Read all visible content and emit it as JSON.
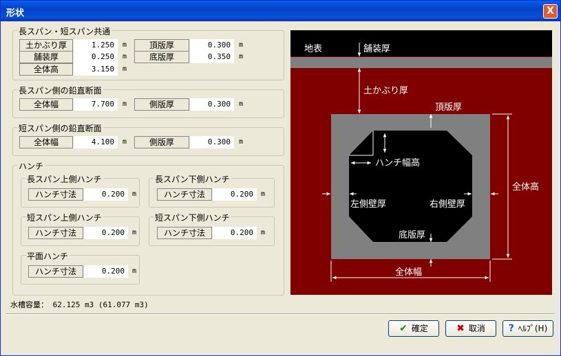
{
  "window": {
    "title": "形状",
    "close": "X"
  },
  "common": {
    "title": "長スパン・短スパン共通",
    "cover": {
      "label": "土かぶり厚",
      "value": "1.250",
      "unit": "m"
    },
    "pave": {
      "label": "舗装厚",
      "value": "0.250",
      "unit": "m"
    },
    "height": {
      "label": "全体高",
      "value": "3.150",
      "unit": "m"
    },
    "top": {
      "label": "頂版厚",
      "value": "0.300",
      "unit": "m"
    },
    "bottom": {
      "label": "底版厚",
      "value": "0.350",
      "unit": "m"
    }
  },
  "long": {
    "title": "長スパン側の鉛直断面",
    "width": {
      "label": "全体幅",
      "value": "7.700",
      "unit": "m"
    },
    "side": {
      "label": "側版厚",
      "value": "0.300",
      "unit": "m"
    }
  },
  "short": {
    "title": "短スパン側の鉛直断面",
    "width": {
      "label": "全体幅",
      "value": "4.100",
      "unit": "m"
    },
    "side": {
      "label": "側版厚",
      "value": "0.300",
      "unit": "m"
    }
  },
  "haunch": {
    "title": "ハンチ",
    "longUpper": {
      "title": "長スパン上側ハンチ",
      "label": "ハンチ寸法",
      "value": "0.200",
      "unit": "m"
    },
    "longLower": {
      "title": "長スパン下側ハンチ",
      "label": "ハンチ寸法",
      "value": "0.200",
      "unit": "m"
    },
    "shortUpper": {
      "title": "短スパン上側ハンチ",
      "label": "ハンチ寸法",
      "value": "0.200",
      "unit": "m"
    },
    "shortLower": {
      "title": "短スパン下側ハンチ",
      "label": "ハンチ寸法",
      "value": "0.200",
      "unit": "m"
    },
    "plane": {
      "title": "平面ハンチ",
      "label": "ハンチ寸法",
      "value": "0.200",
      "unit": "m"
    }
  },
  "status": "水槽容量： 62.125 m3 (61.077 m3)",
  "buttons": {
    "ok": "確定",
    "cancel": "取消",
    "help": "ﾍﾙﾌﾟ(H)"
  },
  "icons": {
    "ok": "check-icon",
    "cancel": "x-icon",
    "help": "question-icon"
  },
  "diagram": {
    "ground": "地表",
    "pave": "舗装厚",
    "cover": "土かぶり厚",
    "top": "頂版厚",
    "haunch": "ハンチ幅高",
    "height": "全体高",
    "left": "左側壁厚",
    "right": "右側壁厚",
    "bottom": "底版厚",
    "width": "全体幅"
  },
  "colors": {
    "soil": "#800000",
    "ground": "#000000",
    "pave": "#808080",
    "box": "#808080",
    "inner": "#000000"
  }
}
